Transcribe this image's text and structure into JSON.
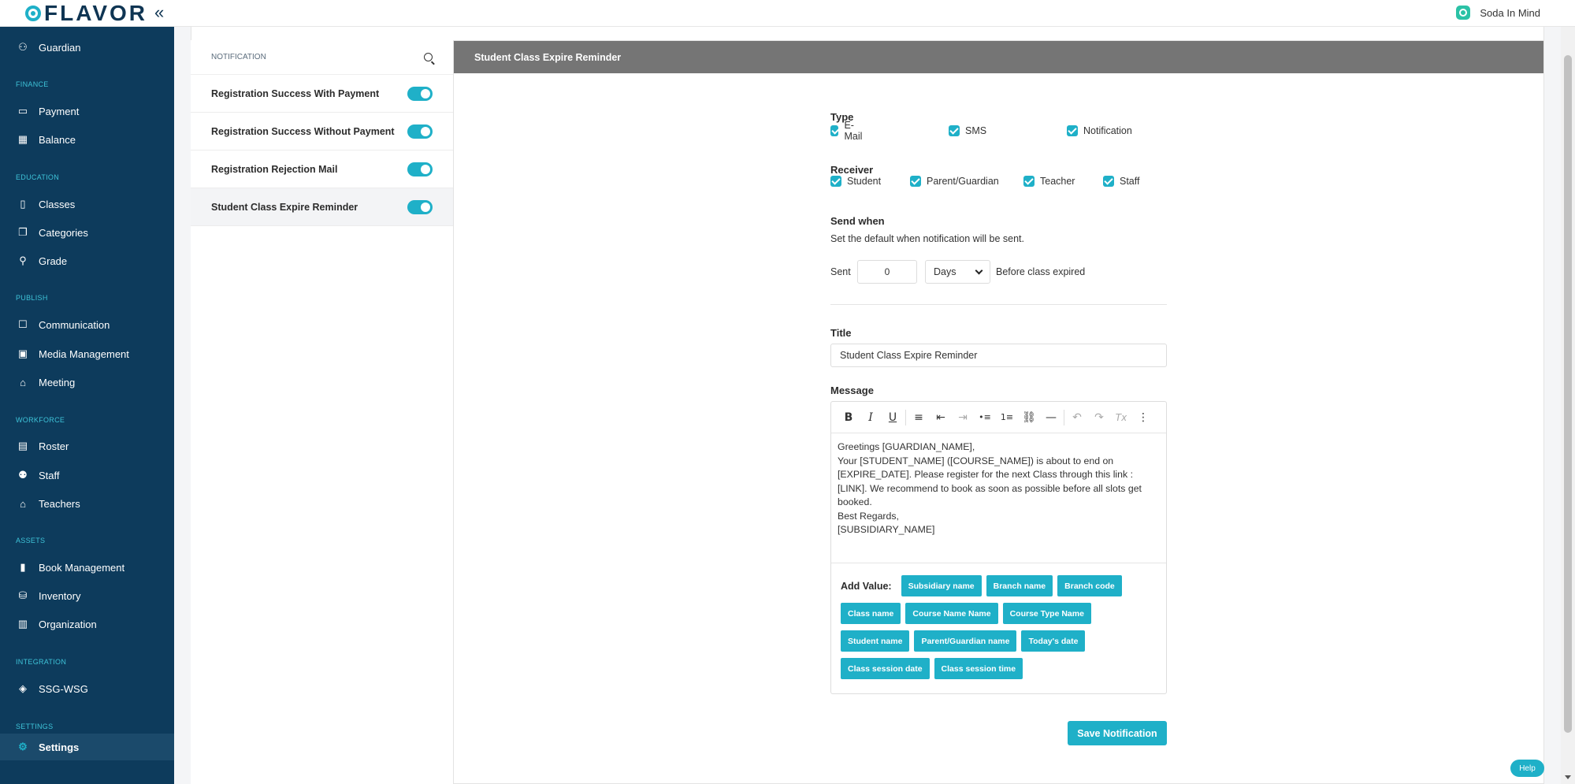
{
  "app": {
    "brand": "FLAVOR",
    "collapse_glyph": "«",
    "org_name": "Soda In Mind"
  },
  "sidebar": {
    "items": [
      {
        "label": "Guardian",
        "icon": "guardian-icon"
      },
      {
        "section": "FINANCE"
      },
      {
        "label": "Payment",
        "icon": "payment-icon"
      },
      {
        "label": "Balance",
        "icon": "balance-icon"
      },
      {
        "section": "EDUCATION"
      },
      {
        "label": "Classes",
        "icon": "classes-icon"
      },
      {
        "label": "Categories",
        "icon": "categories-icon"
      },
      {
        "label": "Grade",
        "icon": "grade-icon"
      },
      {
        "section": "PUBLISH"
      },
      {
        "label": "Communication",
        "icon": "communication-icon"
      },
      {
        "label": "Media Management",
        "icon": "media-icon"
      },
      {
        "label": "Meeting",
        "icon": "meeting-icon"
      },
      {
        "section": "WORKFORCE"
      },
      {
        "label": "Roster",
        "icon": "roster-icon"
      },
      {
        "label": "Staff",
        "icon": "staff-icon"
      },
      {
        "label": "Teachers",
        "icon": "teachers-icon"
      },
      {
        "section": "ASSETS"
      },
      {
        "label": "Book Management",
        "icon": "book-icon"
      },
      {
        "label": "Inventory",
        "icon": "inventory-icon"
      },
      {
        "label": "Organization",
        "icon": "organization-icon"
      },
      {
        "section": "INTEGRATION"
      },
      {
        "label": "SSG-WSG",
        "icon": "ssg-icon"
      },
      {
        "section": "SETTINGS"
      },
      {
        "label": "Settings",
        "icon": "settings-icon",
        "active": true
      }
    ]
  },
  "notifications": {
    "header": "NOTIFICATION",
    "items": [
      {
        "label": "Registration Success With Payment",
        "enabled": true
      },
      {
        "label": "Registration Success Without Payment",
        "enabled": true
      },
      {
        "label": "Registration Rejection Mail",
        "enabled": true
      },
      {
        "label": "Student Class Expire Reminder",
        "enabled": true,
        "active": true
      }
    ]
  },
  "detail": {
    "title": "Student Class Expire Reminder",
    "type_label": "Type",
    "types": [
      {
        "label": "E-Mail",
        "checked": true
      },
      {
        "label": "SMS",
        "checked": true
      },
      {
        "label": "Notification",
        "checked": true
      }
    ],
    "receiver_label": "Receiver",
    "receivers": [
      {
        "label": "Student",
        "checked": true
      },
      {
        "label": "Parent/Guardian",
        "checked": true
      },
      {
        "label": "Teacher",
        "checked": true
      },
      {
        "label": "Staff",
        "checked": true
      }
    ],
    "send_when_label": "Send when",
    "send_when_help": "Set the default when notification will be sent.",
    "sent_label": "Sent",
    "sent_value": "0",
    "unit": "Days",
    "after_text": "Before class expired",
    "title_label": "Title",
    "title_value": "Student Class Expire Reminder",
    "message_label": "Message",
    "message_body": "Greetings [GUARDIAN_NAME],\nYour [STUDENT_NAME] ([COURSE_NAME]) is about to end on [EXPIRE_DATE]. Please register for the next Class through this link : [LINK]. We recommend to book as soon as possible before all slots get booked.\nBest Regards,\n[SUBSIDIARY_NAME]",
    "add_value_label": "Add Value:",
    "chips": [
      [
        "Subsidiary name",
        "Branch name",
        "Branch code"
      ],
      [
        "Class name",
        "Course Name Name",
        "Course Type Name"
      ],
      [
        "Student name",
        "Parent/Guardian name",
        "Today's date"
      ],
      [
        "Class session date",
        "Class session time"
      ]
    ],
    "save_label": "Save Notification"
  },
  "toolbar": {
    "bold": "B",
    "italic": "I",
    "underline": "U",
    "align": "≡",
    "outdent": "⇤",
    "indent": "⇥",
    "bullets": "•≡",
    "numbers": "1≡",
    "link": "⛓",
    "hr": "—",
    "undo": "↶",
    "redo": "↷",
    "clear": "Tx",
    "more": "⋮"
  },
  "help_label": "Help"
}
